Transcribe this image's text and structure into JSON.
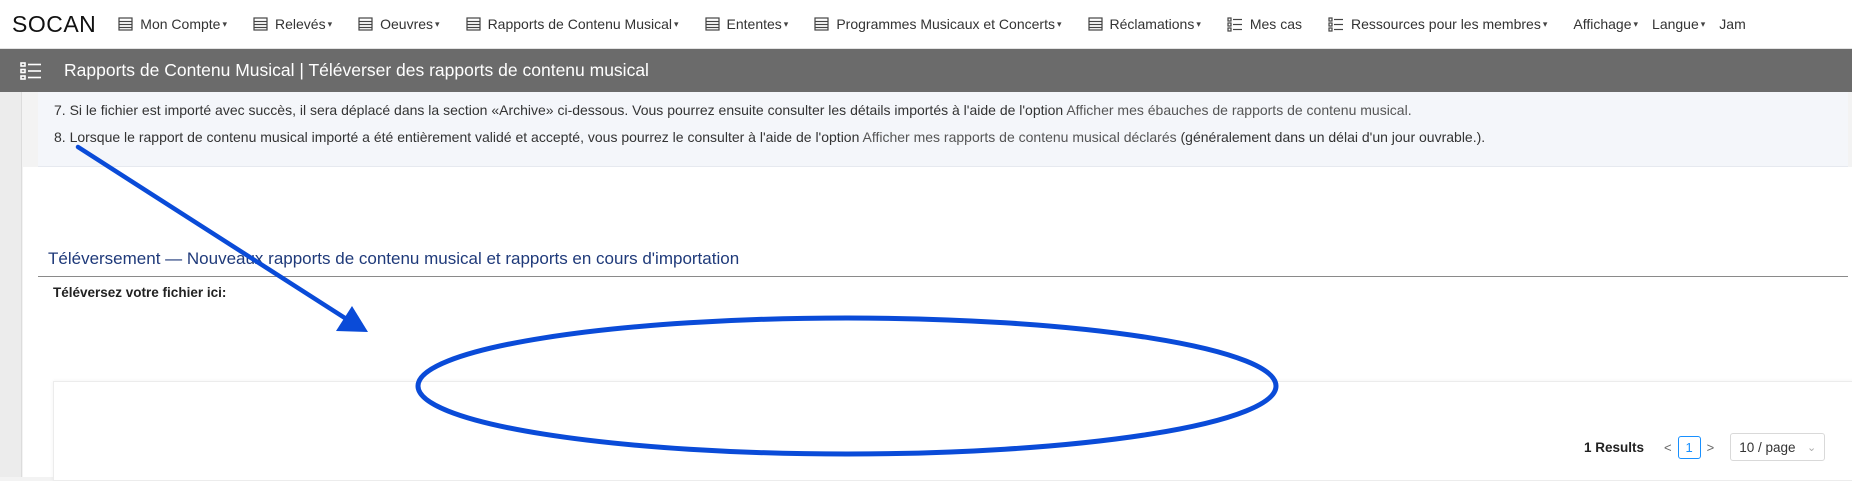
{
  "brand": {
    "logo": "SOCAN"
  },
  "nav": {
    "items": [
      {
        "label": "Mon Compte",
        "icon": "table-icon",
        "caret": true
      },
      {
        "label": "Relevés",
        "icon": "table-icon",
        "caret": true
      },
      {
        "label": "Oeuvres",
        "icon": "table-icon",
        "caret": true
      },
      {
        "label": "Rapports de Contenu Musical",
        "icon": "table-icon",
        "caret": true
      },
      {
        "label": "Ententes",
        "icon": "table-icon",
        "caret": true
      },
      {
        "label": "Programmes Musicaux et Concerts",
        "icon": "table-icon",
        "caret": true
      },
      {
        "label": "Réclamations",
        "icon": "table-icon",
        "caret": true
      },
      {
        "label": "Mes cas",
        "icon": "list-icon",
        "caret": false
      },
      {
        "label": "Ressources pour les membres",
        "icon": "list-icon",
        "caret": true
      },
      {
        "label": "Affichage",
        "icon": "",
        "caret": true
      },
      {
        "label": "Langue",
        "icon": "",
        "caret": true
      },
      {
        "label": "Jam",
        "icon": "",
        "caret": false
      }
    ]
  },
  "titlebar": {
    "title": "Rapports de Contenu Musical | Téléverser des rapports de contenu musical"
  },
  "info": {
    "line7": {
      "before": "7. Si le fichier est importé avec succès, il sera déplacé dans la section «Archive» ci-dessous. Vous pourrez ensuite consulter les détails importés à l'aide de l'option ",
      "link": "Afficher mes ébauches de rapports de contenu musical.",
      "after": ""
    },
    "line8": {
      "before": "8. Lorsque le rapport de contenu musical importé a été entièrement validé et accepté, vous pourrez le consulter à l'aide de l'option ",
      "link": "Afficher mes rapports de contenu musical déclarés",
      "after": " (généralement dans un délai d'un jour ouvrable.)."
    }
  },
  "upload": {
    "section_title": "Téléversement — Nouveaux rapports de contenu musical et rapports en cours d'importation",
    "label": "Téléversez votre fichier ici:"
  },
  "pagination": {
    "results": "1 Results",
    "prev": "<",
    "current_page": "1",
    "next": ">",
    "page_size": "10 / page"
  },
  "colors": {
    "nav_bg": "#ffffff",
    "titlebar_bg": "#6b6b6b",
    "section_title": "#1f3a7a",
    "annotation": "#0a4bd8",
    "pager_accent": "#1890ff"
  }
}
